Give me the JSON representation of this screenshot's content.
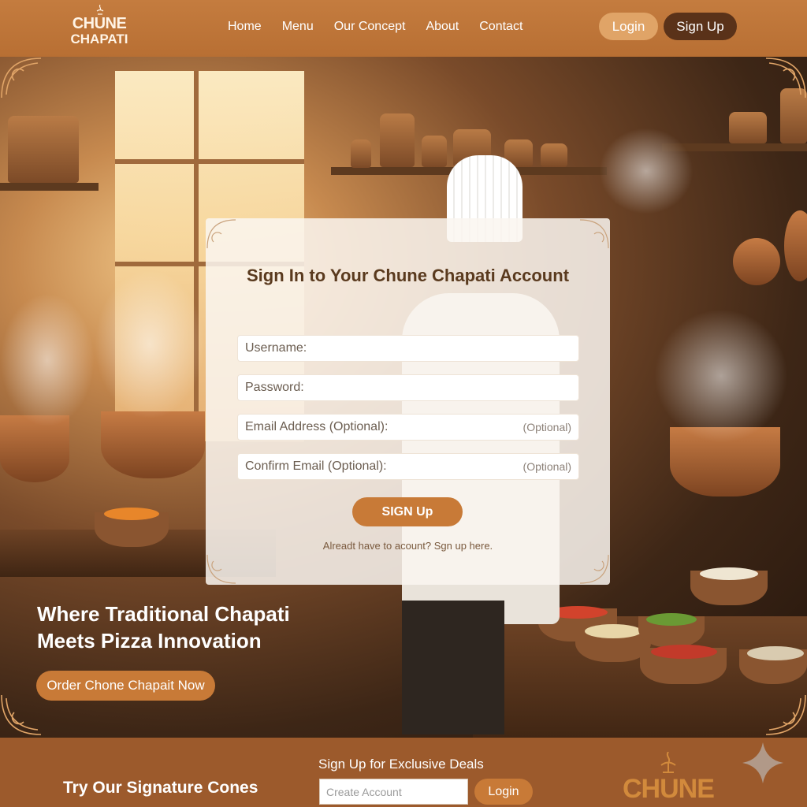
{
  "header": {
    "logo_line1": "CHUNE",
    "logo_line2": "CHAPATI",
    "nav": [
      "Home",
      "Menu",
      "Our Concept",
      "About",
      "Contact"
    ],
    "login_label": "Login",
    "signup_label": "Sign Up"
  },
  "signin_card": {
    "title": "Sign In to Your Chune Chapati Account",
    "fields": [
      {
        "label": "Username:",
        "optional_tag": ""
      },
      {
        "label": "Password:",
        "optional_tag": ""
      },
      {
        "label": "Email Address (Optional):",
        "optional_tag": "(Optional)"
      },
      {
        "label": "Confirm Email (Optional):",
        "optional_tag": "(Optional)"
      }
    ],
    "submit_label": "SIGN Up",
    "footer_link": "Alreadt have to acount? Sgn up here."
  },
  "hero": {
    "title_line1": "Where Traditional Chapati",
    "title_line2": "Meets Pizza Innovation",
    "cta_label": "Order Chone Chapait Now"
  },
  "footer": {
    "cones_text": "Try Our Signature Cones",
    "deals_text": "Sign Up for Exclusive Deals",
    "input_placeholder": "Create Account",
    "login_label": "Login",
    "logo_text": "CHUNE"
  },
  "colors": {
    "header_bg": "#b86f33",
    "accent": "#c87a37",
    "dark_button": "#5a3219",
    "footer_bg": "#9c5a2c"
  },
  "icons": [
    "logo-crest-icon",
    "corner-ornament-icon",
    "sparkle-icon"
  ]
}
